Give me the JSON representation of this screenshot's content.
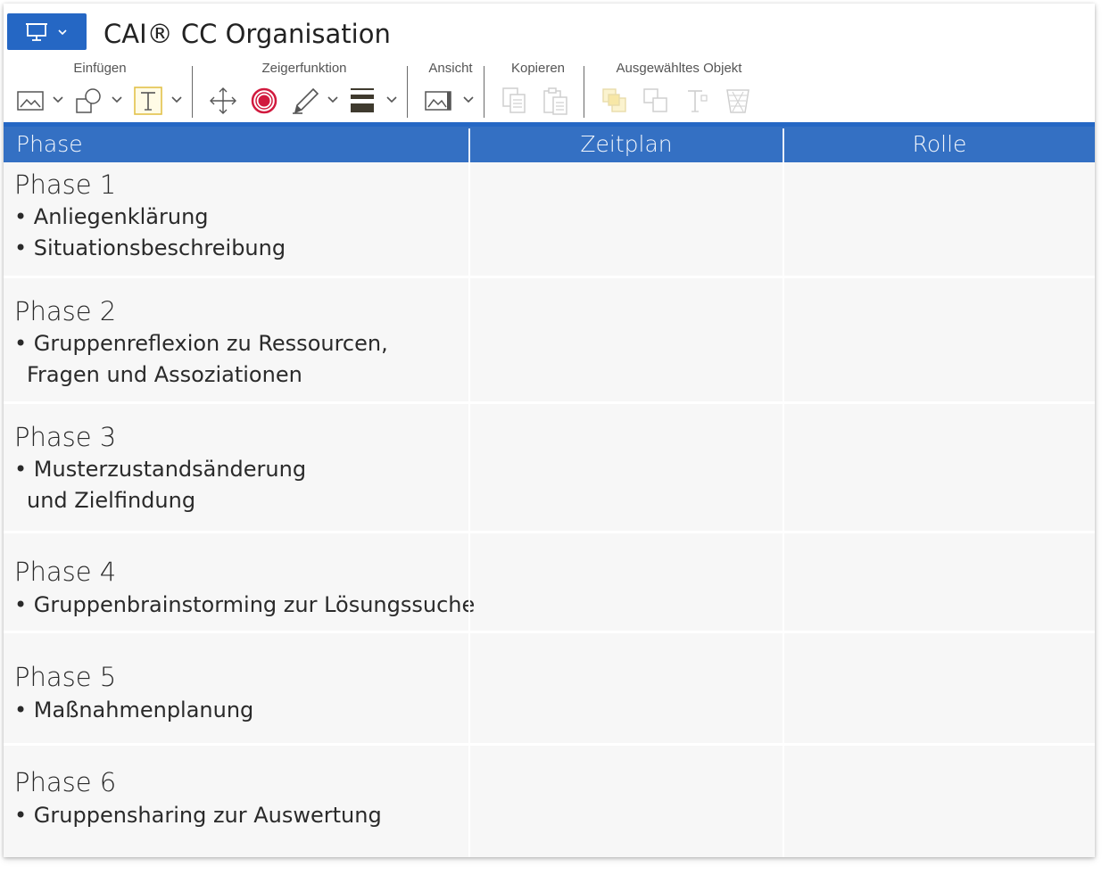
{
  "app": {
    "title": "CAI® CC Organisation",
    "menu_icon": "presentation-screen-icon",
    "accent_color": "#2567c4"
  },
  "ribbon": {
    "groups": [
      {
        "label": "Einfügen"
      },
      {
        "label": "Zeigerfunktion"
      },
      {
        "label": "Ansicht"
      },
      {
        "label": "Kopieren"
      },
      {
        "label": "Ausgewähltes Objekt"
      }
    ],
    "tools": {
      "insert": [
        "image-icon",
        "shapes-icon",
        "text-icon"
      ],
      "pointer": [
        "move-icon",
        "laser-pointer-icon",
        "pen-icon",
        "line-weight-icon"
      ],
      "view": [
        "view-image-icon"
      ],
      "copy": [
        "copy-icon",
        "paste-icon"
      ],
      "selected": [
        "bring-forward-icon",
        "group-icon",
        "text-format-icon",
        "delete-icon"
      ]
    }
  },
  "table": {
    "headers": [
      "Phase",
      "Zeitplan",
      "Rolle"
    ],
    "header_color": "#3470c3",
    "rows": [
      {
        "title": "Phase 1",
        "bullets": [
          "Anliegenklärung",
          "Situationsbeschreibung"
        ]
      },
      {
        "title": "Phase 2",
        "bullets": [
          "Gruppenreflexion zu Ressourcen,"
        ],
        "continuation": "Fragen und Assoziationen"
      },
      {
        "title": "Phase 3",
        "bullets": [
          "Musterzustandsänderung"
        ],
        "continuation": "und Zielfindung"
      },
      {
        "title": "Phase 4",
        "bullets": [
          "Gruppenbrainstorming zur Lösungssuche"
        ]
      },
      {
        "title": "Phase 5",
        "bullets": [
          "Maßnahmenplanung"
        ]
      },
      {
        "title": "Phase 6",
        "bullets": [
          "Gruppensharing zur Auswertung"
        ]
      }
    ]
  }
}
